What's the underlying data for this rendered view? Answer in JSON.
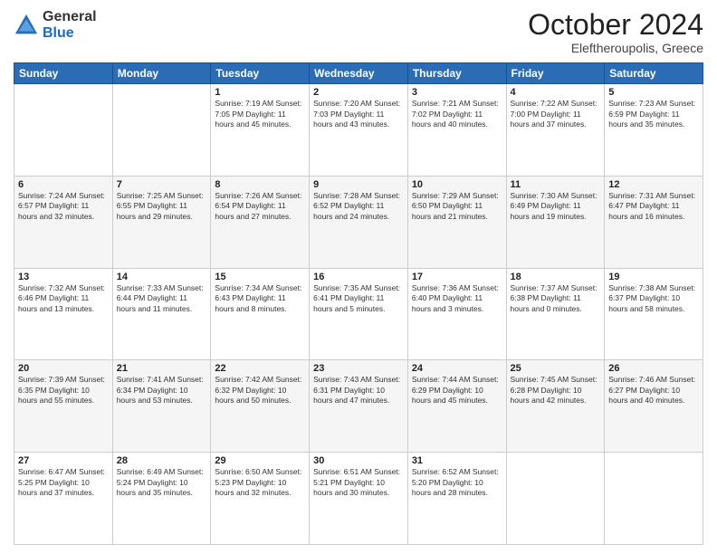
{
  "header": {
    "logo_general": "General",
    "logo_blue": "Blue",
    "month_title": "October 2024",
    "location": "Eleftheroupolis, Greece"
  },
  "weekdays": [
    "Sunday",
    "Monday",
    "Tuesday",
    "Wednesday",
    "Thursday",
    "Friday",
    "Saturday"
  ],
  "weeks": [
    [
      {
        "day": "",
        "info": ""
      },
      {
        "day": "",
        "info": ""
      },
      {
        "day": "1",
        "info": "Sunrise: 7:19 AM\nSunset: 7:05 PM\nDaylight: 11 hours and 45 minutes."
      },
      {
        "day": "2",
        "info": "Sunrise: 7:20 AM\nSunset: 7:03 PM\nDaylight: 11 hours and 43 minutes."
      },
      {
        "day": "3",
        "info": "Sunrise: 7:21 AM\nSunset: 7:02 PM\nDaylight: 11 hours and 40 minutes."
      },
      {
        "day": "4",
        "info": "Sunrise: 7:22 AM\nSunset: 7:00 PM\nDaylight: 11 hours and 37 minutes."
      },
      {
        "day": "5",
        "info": "Sunrise: 7:23 AM\nSunset: 6:59 PM\nDaylight: 11 hours and 35 minutes."
      }
    ],
    [
      {
        "day": "6",
        "info": "Sunrise: 7:24 AM\nSunset: 6:57 PM\nDaylight: 11 hours and 32 minutes."
      },
      {
        "day": "7",
        "info": "Sunrise: 7:25 AM\nSunset: 6:55 PM\nDaylight: 11 hours and 29 minutes."
      },
      {
        "day": "8",
        "info": "Sunrise: 7:26 AM\nSunset: 6:54 PM\nDaylight: 11 hours and 27 minutes."
      },
      {
        "day": "9",
        "info": "Sunrise: 7:28 AM\nSunset: 6:52 PM\nDaylight: 11 hours and 24 minutes."
      },
      {
        "day": "10",
        "info": "Sunrise: 7:29 AM\nSunset: 6:50 PM\nDaylight: 11 hours and 21 minutes."
      },
      {
        "day": "11",
        "info": "Sunrise: 7:30 AM\nSunset: 6:49 PM\nDaylight: 11 hours and 19 minutes."
      },
      {
        "day": "12",
        "info": "Sunrise: 7:31 AM\nSunset: 6:47 PM\nDaylight: 11 hours and 16 minutes."
      }
    ],
    [
      {
        "day": "13",
        "info": "Sunrise: 7:32 AM\nSunset: 6:46 PM\nDaylight: 11 hours and 13 minutes."
      },
      {
        "day": "14",
        "info": "Sunrise: 7:33 AM\nSunset: 6:44 PM\nDaylight: 11 hours and 11 minutes."
      },
      {
        "day": "15",
        "info": "Sunrise: 7:34 AM\nSunset: 6:43 PM\nDaylight: 11 hours and 8 minutes."
      },
      {
        "day": "16",
        "info": "Sunrise: 7:35 AM\nSunset: 6:41 PM\nDaylight: 11 hours and 5 minutes."
      },
      {
        "day": "17",
        "info": "Sunrise: 7:36 AM\nSunset: 6:40 PM\nDaylight: 11 hours and 3 minutes."
      },
      {
        "day": "18",
        "info": "Sunrise: 7:37 AM\nSunset: 6:38 PM\nDaylight: 11 hours and 0 minutes."
      },
      {
        "day": "19",
        "info": "Sunrise: 7:38 AM\nSunset: 6:37 PM\nDaylight: 10 hours and 58 minutes."
      }
    ],
    [
      {
        "day": "20",
        "info": "Sunrise: 7:39 AM\nSunset: 6:35 PM\nDaylight: 10 hours and 55 minutes."
      },
      {
        "day": "21",
        "info": "Sunrise: 7:41 AM\nSunset: 6:34 PM\nDaylight: 10 hours and 53 minutes."
      },
      {
        "day": "22",
        "info": "Sunrise: 7:42 AM\nSunset: 6:32 PM\nDaylight: 10 hours and 50 minutes."
      },
      {
        "day": "23",
        "info": "Sunrise: 7:43 AM\nSunset: 6:31 PM\nDaylight: 10 hours and 47 minutes."
      },
      {
        "day": "24",
        "info": "Sunrise: 7:44 AM\nSunset: 6:29 PM\nDaylight: 10 hours and 45 minutes."
      },
      {
        "day": "25",
        "info": "Sunrise: 7:45 AM\nSunset: 6:28 PM\nDaylight: 10 hours and 42 minutes."
      },
      {
        "day": "26",
        "info": "Sunrise: 7:46 AM\nSunset: 6:27 PM\nDaylight: 10 hours and 40 minutes."
      }
    ],
    [
      {
        "day": "27",
        "info": "Sunrise: 6:47 AM\nSunset: 5:25 PM\nDaylight: 10 hours and 37 minutes."
      },
      {
        "day": "28",
        "info": "Sunrise: 6:49 AM\nSunset: 5:24 PM\nDaylight: 10 hours and 35 minutes."
      },
      {
        "day": "29",
        "info": "Sunrise: 6:50 AM\nSunset: 5:23 PM\nDaylight: 10 hours and 32 minutes."
      },
      {
        "day": "30",
        "info": "Sunrise: 6:51 AM\nSunset: 5:21 PM\nDaylight: 10 hours and 30 minutes."
      },
      {
        "day": "31",
        "info": "Sunrise: 6:52 AM\nSunset: 5:20 PM\nDaylight: 10 hours and 28 minutes."
      },
      {
        "day": "",
        "info": ""
      },
      {
        "day": "",
        "info": ""
      }
    ]
  ]
}
